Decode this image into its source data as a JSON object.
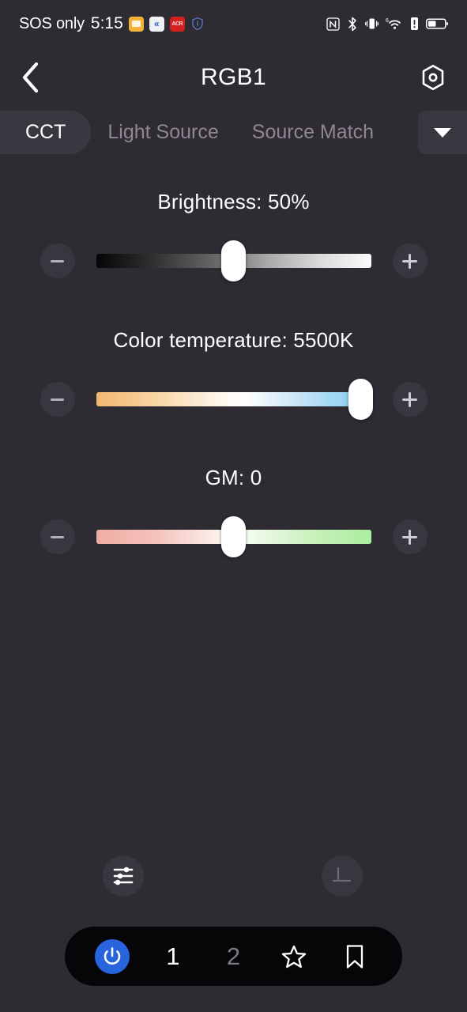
{
  "status_bar": {
    "carrier": "SOS only",
    "time": "5:15",
    "left_app_icons": [
      {
        "name": "folder-app-icon",
        "glyph": ""
      },
      {
        "name": "blue-arrow-app-icon",
        "glyph": "«"
      },
      {
        "name": "acr-recorder-app-icon",
        "glyph": "ACR"
      },
      {
        "name": "shield-app-icon",
        "glyph": ""
      }
    ],
    "right_icons": [
      "nfc-icon",
      "bluetooth-icon",
      "vibrate-icon",
      "wifi-6ghz-icon",
      "alert-icon",
      "battery-icon"
    ]
  },
  "header": {
    "back_label": "Back",
    "title": "RGB1",
    "settings_label": "Settings"
  },
  "tabs": {
    "items": [
      {
        "label": "CCT",
        "active": true
      },
      {
        "label": "Light Source",
        "active": false
      },
      {
        "label": "Source Match",
        "active": false
      }
    ],
    "dropdown_label": "More modes"
  },
  "controls": [
    {
      "id": "brightness",
      "label": "Brightness: 50%",
      "name": "Brightness",
      "value": "50%",
      "percent": 50,
      "decrease_label": "Decrease brightness",
      "increase_label": "Increase brightness"
    },
    {
      "id": "color_temperature",
      "label": "Color temperature: 5500K",
      "name": "Color temperature",
      "value": "5500K",
      "percent": 96,
      "decrease_label": "Decrease color temperature",
      "increase_label": "Increase color temperature"
    },
    {
      "id": "gm",
      "label": "GM: 0",
      "name": "GM",
      "value": "0",
      "percent": 50,
      "decrease_label": "Decrease GM",
      "increase_label": "Increase GM"
    }
  ],
  "tools": {
    "sliders_label": "Effects / adjustments",
    "perpendicular_label": "Alignment"
  },
  "bottom_nav": {
    "power_label": "Power",
    "preset_one": "1",
    "preset_two": "2",
    "favorite_label": "Favorite",
    "bookmark_label": "Bookmark"
  },
  "colors": {
    "background": "#2f2b33",
    "surface": "#3b3740",
    "nav_background": "#060608",
    "accent_blue": "#2764dd",
    "text_primary": "#ffffff",
    "text_muted": "#8c8792"
  }
}
